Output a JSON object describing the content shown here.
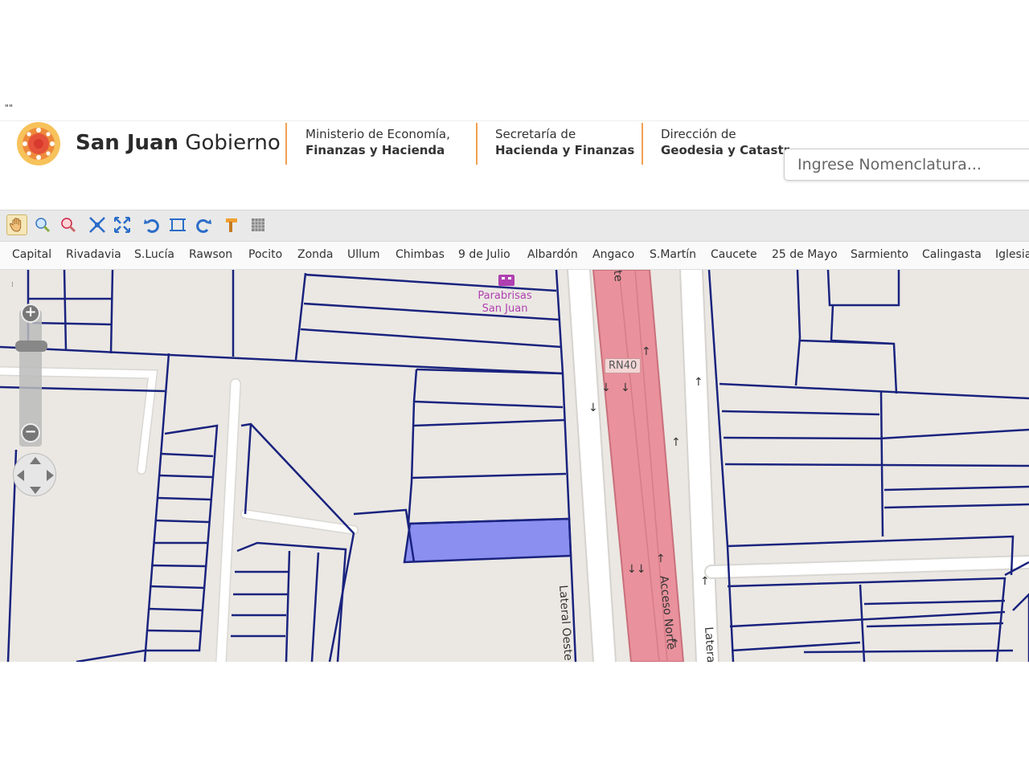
{
  "stray_text": "\"\"",
  "header": {
    "brand_bold": "San Juan",
    "brand_light": "Gobierno",
    "dept1": {
      "line1": "Ministerio de Economía,",
      "line2": "Finanzas y Hacienda"
    },
    "dept2": {
      "line1": "Secretaría de",
      "line2": "Hacienda y Finanzas"
    },
    "dept3": {
      "line1": "Dirección de",
      "line2": "Geodesia y Catastro"
    },
    "search_placeholder": "Ingrese Nomenclatura..."
  },
  "toolbar": {
    "tools": [
      "pan-hand-icon",
      "zoom-in-box-icon",
      "zoom-out-box-icon",
      "zoom-extent-icon",
      "full-extent-icon",
      "undo-icon",
      "select-box-icon",
      "redo-icon",
      "measure-icon",
      "grid-icon"
    ]
  },
  "municipalities": [
    "Capital",
    "Rivadavia",
    "S.Lucía",
    "Rawson",
    "Pocito",
    "Zonda",
    "Ullum",
    "Chimbas",
    "9 de Julio",
    "Albardón",
    "Angaco",
    "S.Martín",
    "Caucete",
    "25 de Mayo",
    "Sarmiento",
    "Calingasta",
    "Iglesia"
  ],
  "map": {
    "poi": {
      "line1": "Parabrisas",
      "line2": "San Juan"
    },
    "route_shield": "RN40",
    "road_west": "Lateral Oeste",
    "road_center": "Acceso Norte",
    "road_center_top": "rte",
    "road_east": "Latera",
    "colors": {
      "parcel_line": "#1a237e",
      "highlight": "#8a8ff0",
      "highway": "#e88e9a",
      "background": "#ebe8e3"
    }
  }
}
